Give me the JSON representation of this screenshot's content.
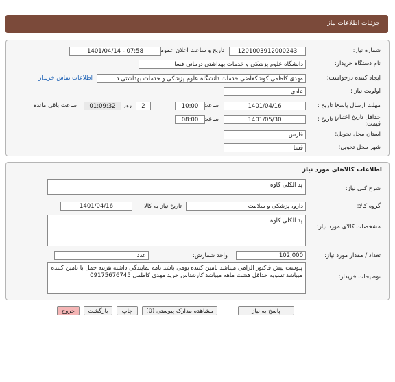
{
  "header": {
    "title": "جزئیات اطلاعات نیاز"
  },
  "need_info": {
    "need_number_label": "شماره نیاز:",
    "need_number": "1201003912000243",
    "announce_label": "تاریخ و ساعت اعلان عمومی:",
    "announce_value": "1401/04/14 - 07:58",
    "buyer_label": "نام دستگاه خریدار:",
    "buyer_value": "دانشگاه علوم پزشکی و خدمات بهداشتی درمانی فسا",
    "requester_label": "ایجاد کننده درخواست:",
    "requester_value": "مهدی  کاظمی کوشکقاضی خدمات دانشگاه علوم پزشکی و خدمات بهداشتی د",
    "contact_link": "اطلاعات تماس خریدار",
    "priority_label": "اولویت نیاز :",
    "priority_value": "عادی",
    "deadline_label": "مهلت ارسال پاسخ:",
    "deadline_until": "تا تاریخ :",
    "deadline_date": "1401/04/16",
    "deadline_time_label": "ساعت",
    "deadline_time": "10:00",
    "remaining_days": "2",
    "remaining_days_label": "روز و",
    "remaining_time": "01:09:32",
    "remaining_label": "ساعت باقی مانده",
    "validity_label": "حداقل تاریخ اعتبار قیمت:",
    "validity_until": "تا تاریخ :",
    "validity_date": "1401/05/30",
    "validity_time_label": "ساعت",
    "validity_time": "08:00",
    "province_label": "استان محل تحویل:",
    "province_value": "فارس",
    "city_label": "شهر محل تحویل:",
    "city_value": "فسا"
  },
  "goods": {
    "section_title": "اطلاعات کالاهای مورد نیاز",
    "summary_label": "شرح کلی نیاز:",
    "summary_value": "پد الکلی کاوه",
    "group_label": "گروه کالا:",
    "group_value": "دارو، پزشکی و سلامت",
    "need_date_label": "تاریخ نیاز به کالا:",
    "need_date": "1401/04/16",
    "spec_label": "مشخصات کالای مورد نیاز:",
    "spec_value": "پد الکلی کاوه",
    "qty_label": "تعداد / مقدار مورد نیاز:",
    "qty_value": "102,000",
    "unit_label": "واحد شمارش:",
    "unit_value": "عدد",
    "desc_label": "توضیحات خریدار:",
    "desc_value": "پیوست پیش فاکتور الزامی میباشد تامین کننده بومی باشد نامه نمایندگی  داشته هزینه حمل با تامین کننده میباشد  تسویه حداقل هشت ماهه میباشد  کارشناس خرید مهدی کاظمی 09175676745"
  },
  "actions": {
    "reply": "پاسخ به نیاز",
    "attachments": "مشاهده مدارک پیوستی (0)",
    "print": "چاپ",
    "back": "بازگشت",
    "exit": "خروج"
  }
}
